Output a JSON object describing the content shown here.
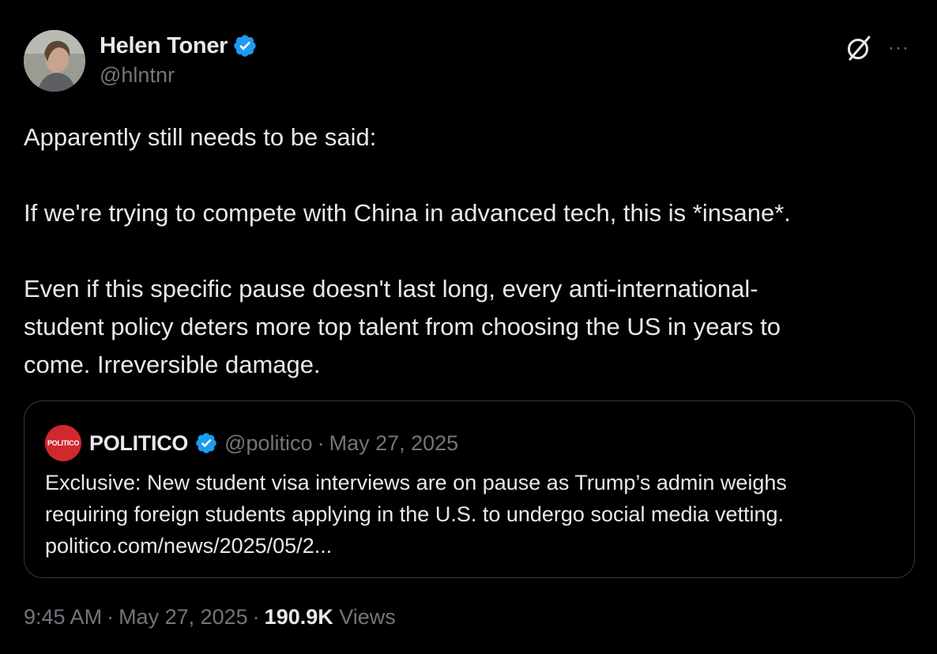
{
  "author": {
    "name": "Helen Toner",
    "handle": "@hlntnr",
    "verified": true
  },
  "header_icons": [
    "grok-icon",
    "more-options-icon"
  ],
  "more_label": "···",
  "body": {
    "paragraphs": [
      "Apparently still needs to be said:",
      "If we're trying to compete with China in advanced tech, this is *insane*.",
      "Even if this specific pause doesn't last long, every anti-international-\nstudent policy deters more top talent from choosing the US in years to\ncome. Irreversible damage."
    ]
  },
  "quoted_tweet": {
    "avatar_text": "POLITICO",
    "name": "POLITICO",
    "verified": true,
    "handle": "@politico",
    "separator": "·",
    "date": "May 27, 2025",
    "text_lines": [
      "Exclusive: New student visa interviews are on pause as Trump’s admin weighs",
      "requiring foreign students applying in the U.S. to undergo social media vetting.",
      "politico.com/news/2025/05/2..."
    ]
  },
  "footer": {
    "time": "9:45 AM",
    "separator": "·",
    "date": "May 27, 2025",
    "views_count": "190.9K",
    "views_label": "Views"
  },
  "colors": {
    "background": "#000000",
    "text": "#e7e9ea",
    "muted": "#71767b",
    "verified_blue": "#1d9bf0",
    "border": "#333639",
    "politico_red": "#d1282d"
  }
}
